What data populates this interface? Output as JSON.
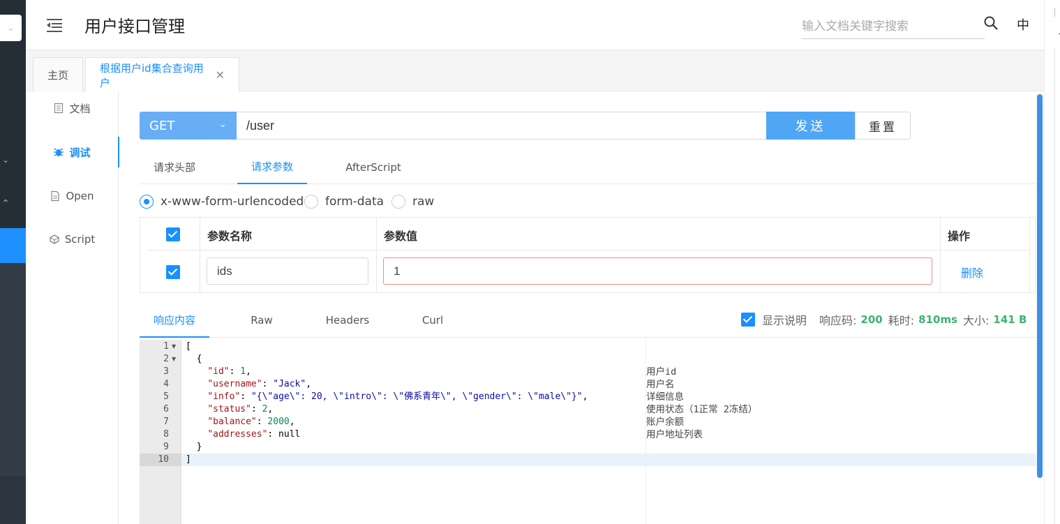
{
  "header": {
    "title": "用户接口管理",
    "search_placeholder": "输入文档关键字搜索",
    "lang": "中"
  },
  "tabs": [
    {
      "label": "主页"
    },
    {
      "label": "根据用户id集合查询用户"
    }
  ],
  "submenu": [
    {
      "label": "文档",
      "icon": "doc-icon"
    },
    {
      "label": "调试",
      "icon": "bug-icon",
      "active": true
    },
    {
      "label": "Open",
      "icon": "file-icon"
    },
    {
      "label": "Script",
      "icon": "code-icon"
    }
  ],
  "request": {
    "method": "GET",
    "url": "/user",
    "send_label": "发送",
    "reset_label": "重置"
  },
  "request_tabs": [
    "请求头部",
    "请求参数",
    "AfterScript"
  ],
  "body_types": [
    "x-www-form-urlencoded",
    "form-data",
    "raw"
  ],
  "params_table": {
    "headers": {
      "name": "参数名称",
      "value": "参数值",
      "action": "操作"
    },
    "rows": [
      {
        "name": "ids",
        "value": "1",
        "action": "删除"
      }
    ]
  },
  "response_tabs": [
    "响应内容",
    "Raw",
    "Headers",
    "Curl"
  ],
  "response_meta": {
    "show_desc_label": "显示说明",
    "code_label": "响应码:",
    "code": "200",
    "time_label": "耗时:",
    "time": "810ms",
    "size_label": "大小:",
    "size": "141 B"
  },
  "response_lines": [
    "1",
    "2",
    "3",
    "4",
    "5",
    "6",
    "7",
    "8",
    "9",
    "10"
  ],
  "response_desc": [
    "用户id",
    "用户名",
    "详细信息",
    "使用状态（1正常 2冻结）",
    "账户余额",
    "用户地址列表"
  ],
  "colors": {
    "accent": "#1890ff",
    "method_bg": "#67aef5",
    "send_bg": "#4fa6f4",
    "success": "#3cb371"
  }
}
